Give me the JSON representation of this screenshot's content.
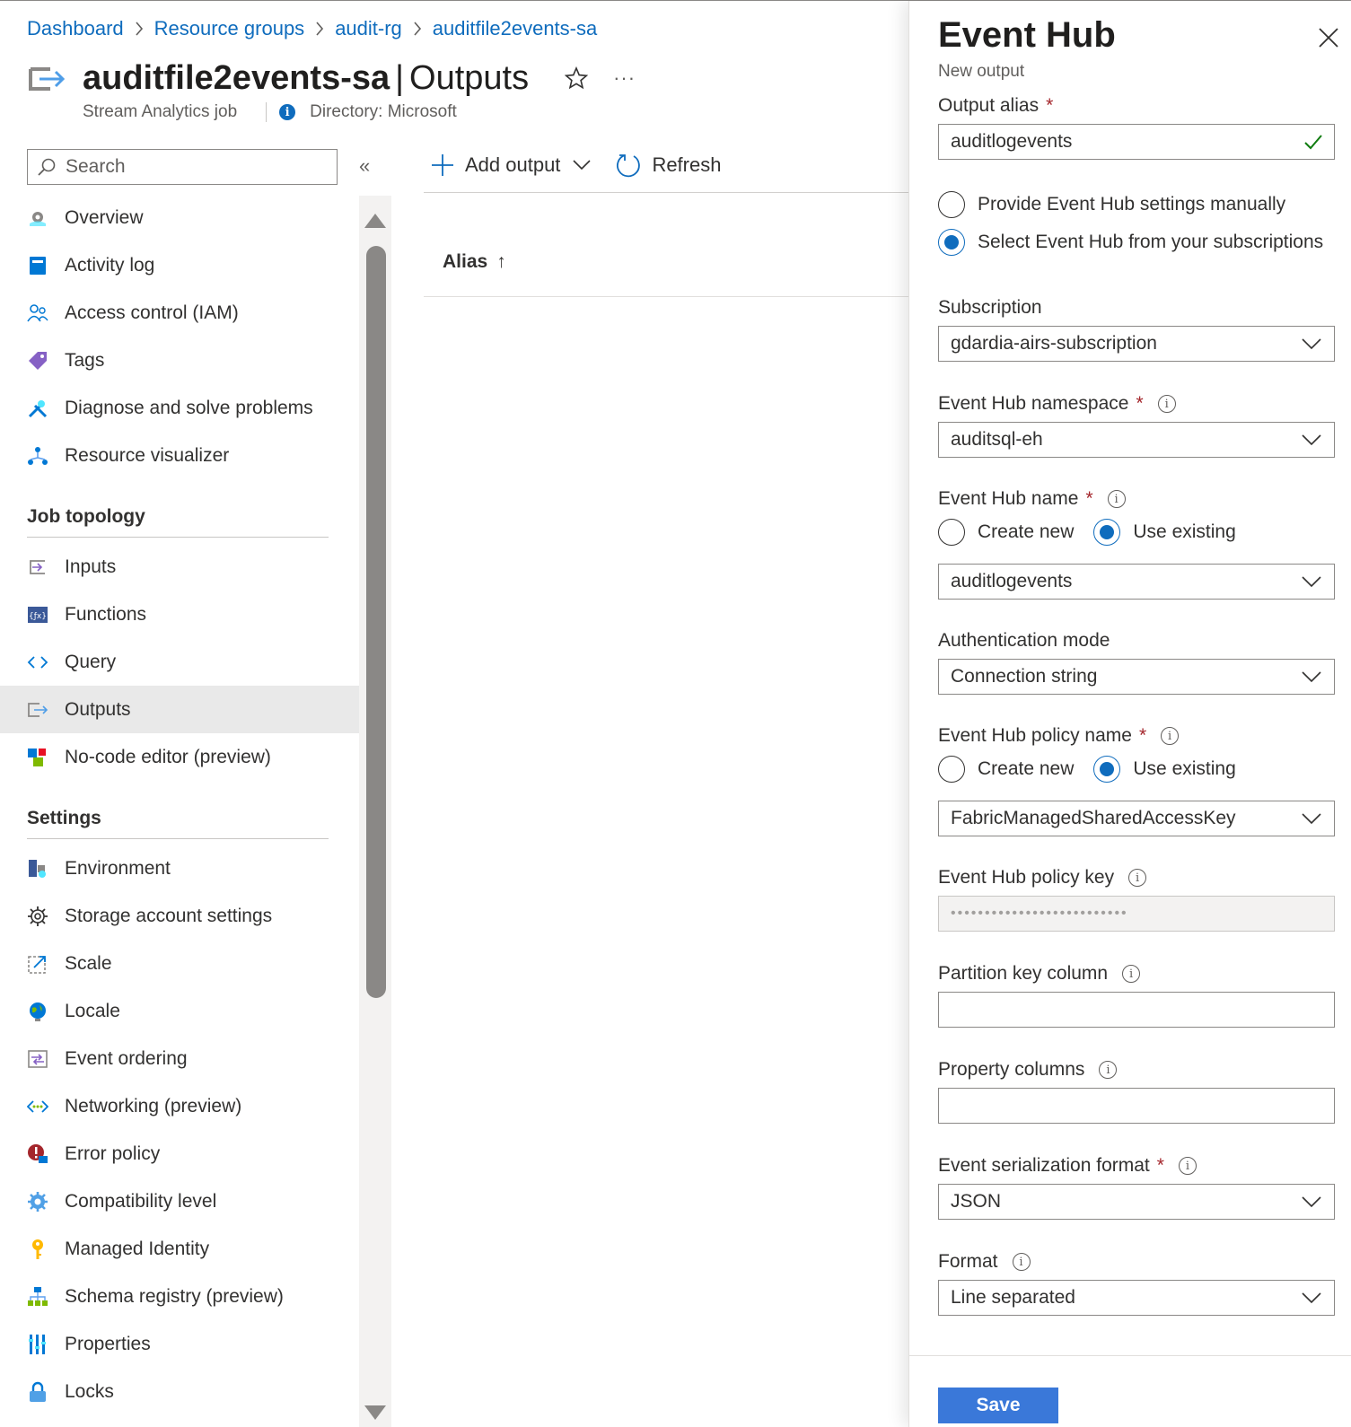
{
  "breadcrumb": [
    "Dashboard",
    "Resource groups",
    "audit-rg",
    "auditfile2events-sa"
  ],
  "page": {
    "title": "auditfile2events-sa",
    "title_sep": "|",
    "section": "Outputs",
    "resource_type": "Stream Analytics job",
    "directory": "Directory: Microsoft",
    "more": "···"
  },
  "search": {
    "placeholder": "Search"
  },
  "collapse_glyph": "«",
  "nav": {
    "top_items": [
      {
        "label": "Overview",
        "icon": "gear-cloud-icon"
      },
      {
        "label": "Activity log",
        "icon": "log-icon"
      },
      {
        "label": "Access control (IAM)",
        "icon": "people-icon"
      },
      {
        "label": "Tags",
        "icon": "tag-icon"
      },
      {
        "label": "Diagnose and solve problems",
        "icon": "wrench-icon"
      },
      {
        "label": "Resource visualizer",
        "icon": "hierarchy-icon"
      }
    ],
    "job_topology": {
      "header": "Job topology",
      "items": [
        {
          "label": "Inputs",
          "icon": "input-icon"
        },
        {
          "label": "Functions",
          "icon": "function-icon"
        },
        {
          "label": "Query",
          "icon": "code-icon"
        },
        {
          "label": "Outputs",
          "icon": "output-icon"
        },
        {
          "label": "No-code editor (preview)",
          "icon": "blocks-icon"
        }
      ]
    },
    "settings": {
      "header": "Settings",
      "items": [
        {
          "label": "Environment",
          "icon": "environment-icon"
        },
        {
          "label": "Storage account settings",
          "icon": "gear-icon"
        },
        {
          "label": "Scale",
          "icon": "scale-icon"
        },
        {
          "label": "Locale",
          "icon": "globe-icon"
        },
        {
          "label": "Event ordering",
          "icon": "ordering-icon"
        },
        {
          "label": "Networking (preview)",
          "icon": "network-icon"
        },
        {
          "label": "Error policy",
          "icon": "error-icon"
        },
        {
          "label": "Compatibility level",
          "icon": "compat-gear-icon"
        },
        {
          "label": "Managed Identity",
          "icon": "key-icon"
        },
        {
          "label": "Schema registry (preview)",
          "icon": "schema-icon"
        },
        {
          "label": "Properties",
          "icon": "properties-icon"
        },
        {
          "label": "Locks",
          "icon": "lock-icon"
        }
      ]
    }
  },
  "toolbar": {
    "add_output": "Add output",
    "refresh": "Refresh"
  },
  "table": {
    "alias_header": "Alias",
    "sort_arrow": "↑"
  },
  "panel": {
    "title": "Event Hub",
    "subtitle": "New output",
    "output_alias": {
      "label": "Output alias",
      "required": "*",
      "value": "auditlogevents"
    },
    "mode_options": {
      "manual": "Provide Event Hub settings manually",
      "subscription": "Select Event Hub from your subscriptions",
      "selected": "subscription"
    },
    "subscription": {
      "label": "Subscription",
      "value": "gdardia-airs-subscription"
    },
    "namespace": {
      "label": "Event Hub namespace",
      "required": "*",
      "value": "auditsql-eh"
    },
    "hub_name": {
      "label": "Event Hub name",
      "required": "*",
      "create_new": "Create new",
      "use_existing": "Use existing",
      "selected": "use_existing",
      "value": "auditlogevents"
    },
    "auth_mode": {
      "label": "Authentication mode",
      "value": "Connection string"
    },
    "policy_name": {
      "label": "Event Hub policy name",
      "required": "*",
      "create_new": "Create new",
      "use_existing": "Use existing",
      "selected": "use_existing",
      "value": "FabricManagedSharedAccessKey"
    },
    "policy_key": {
      "label": "Event Hub policy key",
      "value": "••••••••••••••••••••••••••"
    },
    "partition_key": {
      "label": "Partition key column",
      "value": ""
    },
    "property_columns": {
      "label": "Property columns",
      "value": ""
    },
    "serialization": {
      "label": "Event serialization format",
      "required": "*",
      "value": "JSON"
    },
    "format": {
      "label": "Format",
      "value": "Line separated"
    },
    "save": "Save",
    "info_glyph": "i"
  },
  "colors": {
    "accent": "#0f6cbd",
    "required": "#a4262c",
    "save_bg": "#3a78d9",
    "active_nav": "#e9e9e9"
  }
}
